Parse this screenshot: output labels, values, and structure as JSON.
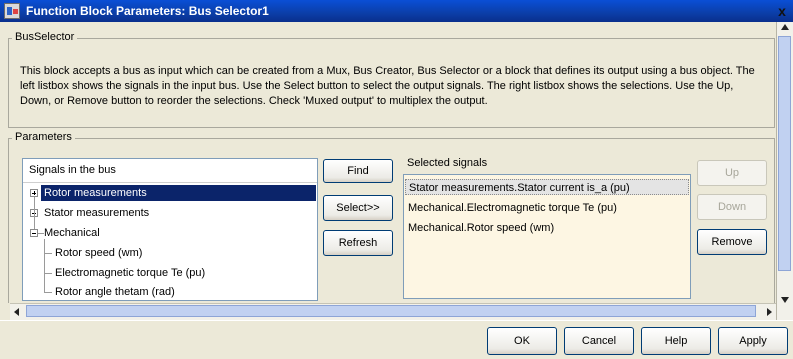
{
  "window": {
    "title": "Function Block Parameters: Bus Selector1",
    "close_label": "x"
  },
  "block_group": {
    "label": "BusSelector",
    "description": "This block accepts a bus as input which can be created from a Mux, Bus Creator, Bus Selector or a block that defines its output using a bus object. The left listbox shows the signals in the input bus. Use the Select button to select the output signals. The right listbox shows the selections. Use the Up, Down, or Remove button to reorder the selections. Check 'Muxed output' to multiplex the output."
  },
  "parameters_group": {
    "label": "Parameters"
  },
  "signals_list": {
    "header": "Signals in the bus",
    "items": [
      {
        "label": "Rotor measurements",
        "selected": true
      },
      {
        "label": "Stator measurements"
      },
      {
        "label": "Mechanical"
      },
      {
        "label": "Rotor speed (wm)"
      },
      {
        "label": "Electromagnetic torque Te (pu)"
      },
      {
        "label": "Rotor angle thetam (rad)"
      }
    ]
  },
  "middle_buttons": {
    "find": "Find",
    "select": "Select>>",
    "refresh": "Refresh"
  },
  "selected_signals": {
    "header": "Selected signals",
    "items": [
      "Stator measurements.Stator current is_a (pu)",
      "Mechanical.Electromagnetic torque Te (pu)",
      "Mechanical.Rotor speed (wm)"
    ]
  },
  "right_buttons": {
    "up": "Up",
    "down": "Down",
    "remove": "Remove"
  },
  "footer_buttons": {
    "ok": "OK",
    "cancel": "Cancel",
    "help": "Help",
    "apply": "Apply"
  },
  "colors": {
    "titlebar": "#0b3ea8",
    "selection": "#0b246a",
    "selected_panel_bg": "#fdf6e3"
  }
}
